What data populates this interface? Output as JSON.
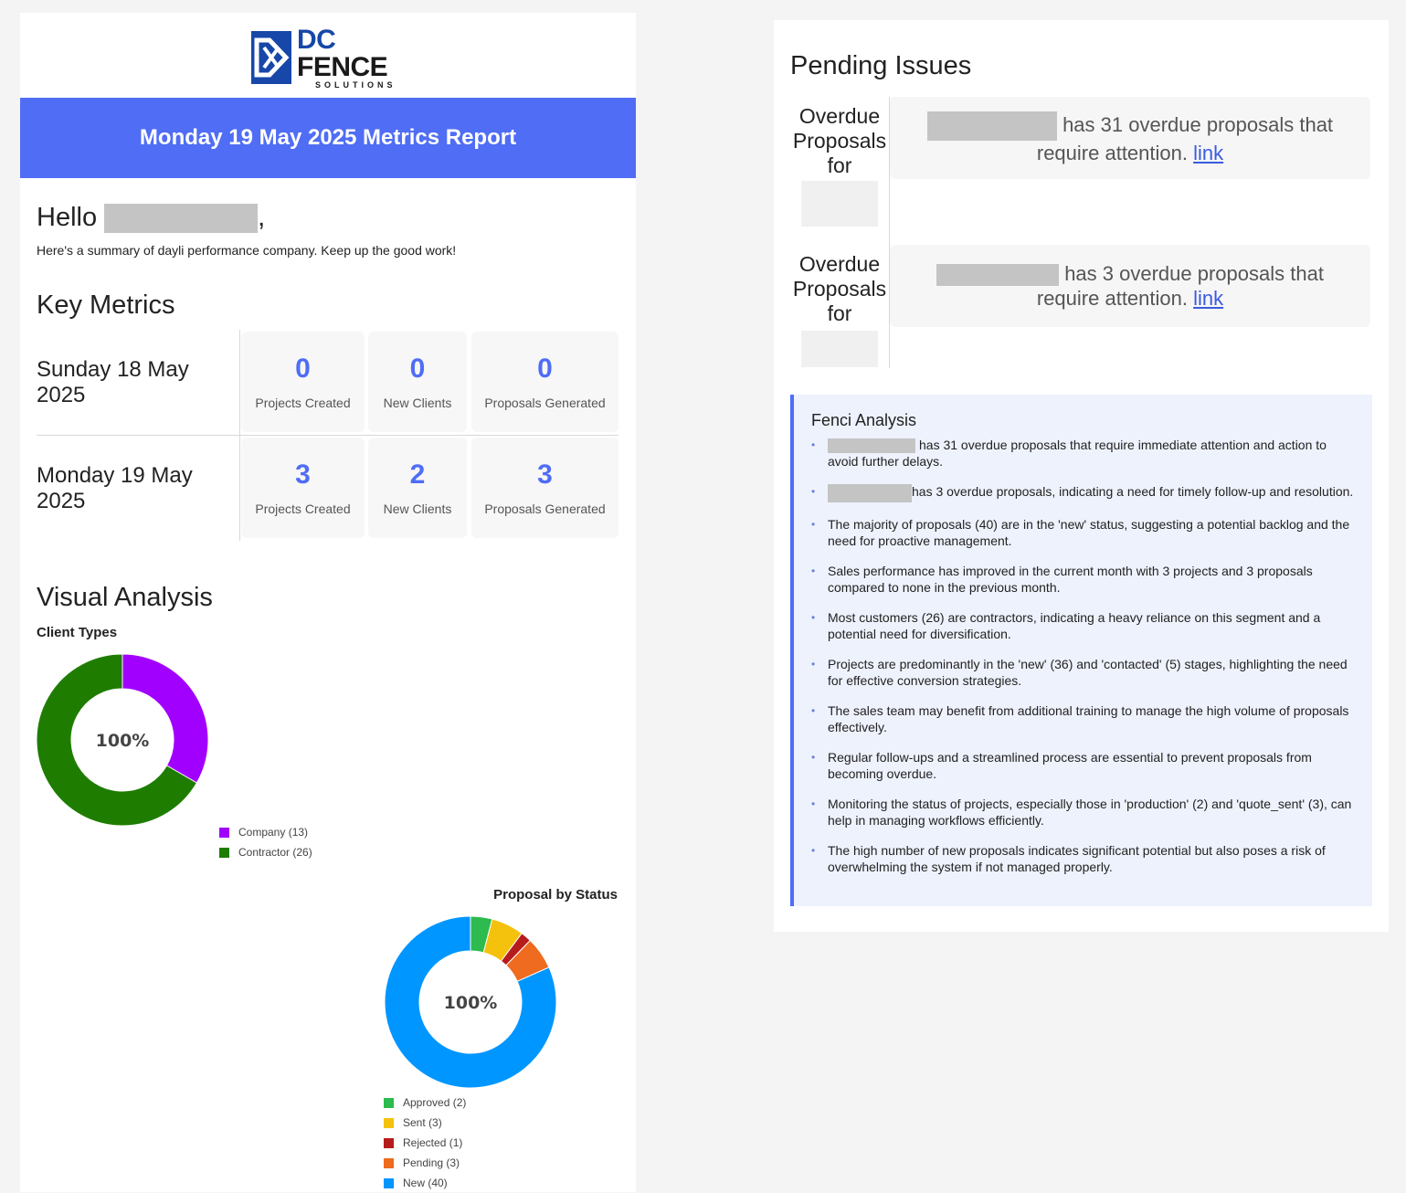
{
  "brand": {
    "logo_main_a": "DC",
    "logo_main_b": "FENCE",
    "logo_sub": "SOLUTIONS"
  },
  "report": {
    "title": "Monday 19 May 2025 Metrics Report",
    "hello_prefix": "Hello",
    "hello_suffix": ",",
    "summary": "Here's a summary of dayli performance company. Keep up the good work!"
  },
  "key_metrics": {
    "heading": "Key Metrics",
    "rows": [
      {
        "date": "Sunday 18 May 2025",
        "projects_created": "0",
        "projects_label": "Projects Created",
        "new_clients": "0",
        "clients_label": "New Clients",
        "proposals_generated": "0",
        "proposals_label": "Proposals Generated"
      },
      {
        "date": "Monday 19 May 2025",
        "projects_created": "3",
        "projects_label": "Projects Created",
        "new_clients": "2",
        "clients_label": "New Clients",
        "proposals_generated": "3",
        "proposals_label": "Proposals Generated"
      }
    ]
  },
  "visual_analysis": {
    "heading": "Visual Analysis"
  },
  "chart_data": [
    {
      "type": "pie",
      "title": "Client Types",
      "center_label": "100%",
      "categories": [
        "Company (13)",
        "Contractor (26)"
      ],
      "values": [
        13,
        26
      ],
      "colors": [
        "#a100ff",
        "#1e7d00"
      ]
    },
    {
      "type": "pie",
      "title": "Proposal by Status",
      "center_label": "100%",
      "categories": [
        "Approved (2)",
        "Sent (3)",
        "Rejected (1)",
        "Pending (3)",
        "New (40)"
      ],
      "values": [
        2,
        3,
        1,
        3,
        40
      ],
      "colors": [
        "#2dba4e",
        "#f4c20d",
        "#b71c1c",
        "#ee6b1f",
        "#0096ff"
      ]
    }
  ],
  "pending": {
    "heading": "Pending Issues",
    "items": [
      {
        "label": "Overdue Proposals for",
        "text": "has 31 overdue proposals that require attention.",
        "link": "link"
      },
      {
        "label": "Overdue Proposals for",
        "text": "has 3 overdue proposals that require attention.",
        "link": "link"
      }
    ]
  },
  "fenci": {
    "title": "Fenci Analysis",
    "items": [
      "has 31 overdue proposals that require immediate attention and action to avoid further delays.",
      "has 3 overdue proposals, indicating a need for timely follow-up and resolution.",
      "The majority of proposals (40) are in the 'new' status, suggesting a potential backlog and the need for proactive management.",
      "Sales performance has improved in the current month with 3 projects and 3 proposals compared to none in the previous month.",
      "Most customers (26) are contractors, indicating a heavy reliance on this segment and a potential need for diversification.",
      "Projects are predominantly in the 'new' (36) and 'contacted' (5) stages, highlighting the need for effective conversion strategies.",
      "The sales team may benefit from additional training to manage the high volume of proposals effectively.",
      "Regular follow-ups and a streamlined process are essential to prevent proposals from becoming overdue.",
      "Monitoring the status of projects, especially those in 'production' (2) and 'quote_sent' (3), can help in managing workflows efficiently.",
      "The high number of new proposals indicates significant potential but also poses a risk of overwhelming the system if not managed properly."
    ]
  }
}
